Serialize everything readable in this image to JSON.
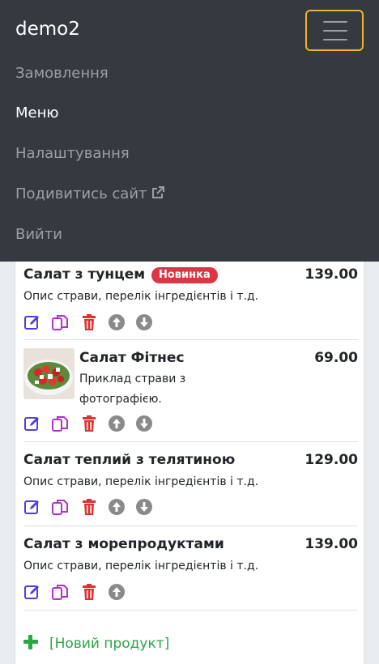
{
  "navbar": {
    "brand": "demo2",
    "toggler_icon": "hamburger-icon",
    "items": [
      {
        "label": "Замовлення",
        "active": false
      },
      {
        "label": "Меню",
        "active": true
      },
      {
        "label": "Налаштування",
        "active": false
      },
      {
        "label": "Подивитись сайт",
        "active": false,
        "icon": "external-link-icon"
      },
      {
        "label": "Вийти",
        "active": false
      }
    ]
  },
  "products": [
    {
      "name": "Салат з тунцем",
      "badge": "Новинка",
      "price": "139.00",
      "description": "Опис страви, перелік інгредієнтів і т.д.",
      "has_photo": false
    },
    {
      "name": "Салат Фітнес",
      "price": "69.00",
      "description_line1": "Приклад страви з",
      "description_line2": "фотографією.",
      "has_photo": true
    },
    {
      "name": "Салат теплий з телятиною",
      "price": "129.00",
      "description": "Опис страви, перелік інгредієнтів і т.д.",
      "has_photo": false
    },
    {
      "name": "Салат з морепродуктами",
      "price": "139.00",
      "description": "Опис страви, перелік інгредієнтів і т.д.",
      "has_photo": false
    }
  ],
  "actions": {
    "edit_icon": "edit-icon",
    "copy_icon": "copy-icon",
    "delete_icon": "trash-icon",
    "move_up_icon": "arrow-up-circle-icon",
    "move_down_icon": "arrow-down-circle-icon"
  },
  "new_product_label": "[Новий продукт]",
  "colors": {
    "navbar_bg": "#343a40",
    "badge_bg": "#dc3545",
    "edit": "#4b3fe0",
    "copy": "#b030c8",
    "delete": "#e03030",
    "move": "#8a8a8a",
    "new_product": "#28a745",
    "toggler_focus": "#f0b429"
  }
}
